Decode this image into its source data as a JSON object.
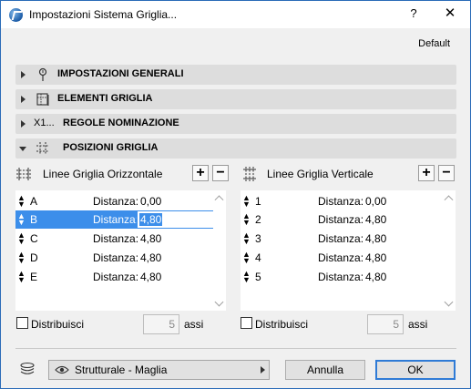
{
  "window": {
    "title": "Impostazioni Sistema Griglia..."
  },
  "titlebar": {
    "help": "?",
    "close": "✕"
  },
  "preset": "Default",
  "sections": [
    {
      "label": "IMPOSTAZIONI GENERALI",
      "icon": "pin-icon",
      "expanded": false
    },
    {
      "label": "ELEMENTI GRIGLIA",
      "icon": "grid-element-icon",
      "expanded": false
    },
    {
      "label": "REGOLE NOMINAZIONE",
      "icon": "naming-icon",
      "icon_text": "X1...",
      "expanded": false
    },
    {
      "label": "POSIZIONI GRIGLIA",
      "icon": "grid-positions-icon",
      "expanded": true
    }
  ],
  "horizontal": {
    "title": "Linee Griglia Orizzontale",
    "add": "+",
    "remove": "−",
    "rows": [
      {
        "name": "A",
        "label": "Distanza:",
        "value": "0,00"
      },
      {
        "name": "B",
        "label": "Distanza:",
        "value": "4,80"
      },
      {
        "name": "C",
        "label": "Distanza:",
        "value": "4,80"
      },
      {
        "name": "D",
        "label": "Distanza:",
        "value": "4,80"
      },
      {
        "name": "E",
        "label": "Distanza:",
        "value": "4,80"
      }
    ],
    "selected_row": 1,
    "distribute_label": "Distribuisci",
    "distribute_count": "5",
    "unit": "assi"
  },
  "vertical": {
    "title": "Linee Griglia Verticale",
    "add": "+",
    "remove": "−",
    "rows": [
      {
        "name": "1",
        "label": "Distanza:",
        "value": "0,00"
      },
      {
        "name": "2",
        "label": "Distanza:",
        "value": "4,80"
      },
      {
        "name": "3",
        "label": "Distanza:",
        "value": "4,80"
      },
      {
        "name": "4",
        "label": "Distanza:",
        "value": "4,80"
      },
      {
        "name": "5",
        "label": "Distanza:",
        "value": "4,80"
      }
    ],
    "distribute_label": "Distribuisci",
    "distribute_count": "5",
    "unit": "assi"
  },
  "footer": {
    "layer": "Strutturale - Maglia",
    "cancel": "Annulla",
    "ok": "OK"
  },
  "colors": {
    "selection": "#3c8eea",
    "section_bg": "#dddddd",
    "dialog_bg": "#f0f0f0"
  }
}
